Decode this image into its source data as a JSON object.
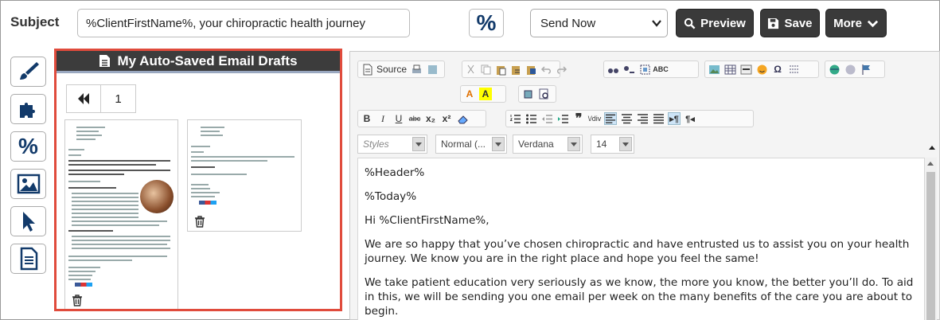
{
  "header": {
    "subject_label": "Subject",
    "subject_value": "%ClientFirstName%, your chiropractic health journey",
    "percent_label": "%",
    "send_option": "Send Now",
    "preview_label": "Preview",
    "save_label": "Save",
    "more_label": "More"
  },
  "sidebar": {
    "tools": [
      "paintbrush-icon",
      "puzzle-icon",
      "percent-icon",
      "image-icon",
      "cursor-icon",
      "document-icon"
    ],
    "percent_label": "%"
  },
  "drafts": {
    "title": "My Auto-Saved Email Drafts",
    "page_number": "1"
  },
  "editor": {
    "source_label": "Source",
    "styles_placeholder": "Styles",
    "format_value": "Normal (...",
    "font_value": "Verdana",
    "size_value": "14",
    "content": {
      "p1": "%Header%",
      "p2": "%Today%",
      "p3": "Hi %ClientFirstName%,",
      "p4": "We are so happy that you’ve chosen chiropractic and have entrusted us to assist you on your health journey. We know you are in the right place and hope you feel the same!",
      "p5": "We take patient education very seriously as we know, the more you know, the better you’ll do. To aid in this, we will be sending you one email per week on the many benefits of the care you are about to begin."
    }
  },
  "colors": {
    "drafts_border": "#e04b3c",
    "dark_button": "#3a3a3a",
    "percent_blue": "#123a6a",
    "drafts_header": "#3c3c3c"
  }
}
